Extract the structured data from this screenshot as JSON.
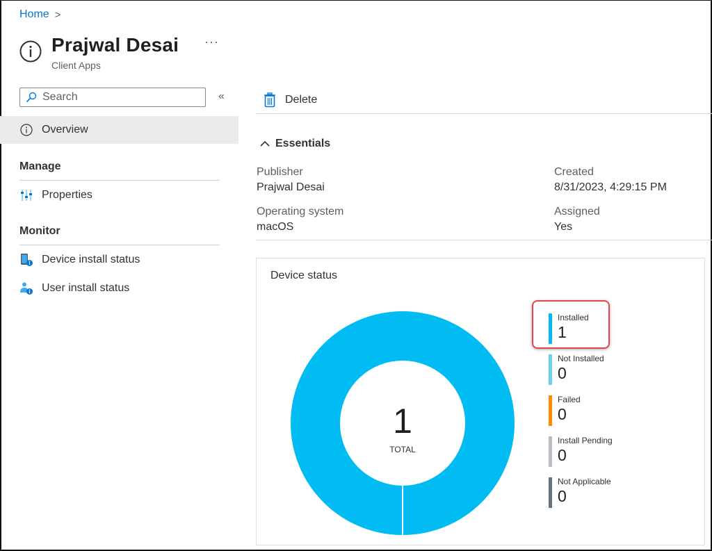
{
  "breadcrumb": {
    "home": "Home",
    "separator": ">"
  },
  "header": {
    "title": "Prajwal Desai",
    "subtitle": "Client Apps",
    "more": "···"
  },
  "sidebar": {
    "search_placeholder": "Search",
    "collapse": "«",
    "overview": "Overview",
    "sections": [
      {
        "heading": "Manage",
        "items": [
          {
            "label": "Properties",
            "icon": "properties-icon"
          }
        ]
      },
      {
        "heading": "Monitor",
        "items": [
          {
            "label": "Device install status",
            "icon": "device-install-status-icon"
          },
          {
            "label": "User install status",
            "icon": "user-install-status-icon"
          }
        ]
      }
    ]
  },
  "toolbar": {
    "delete_label": "Delete"
  },
  "essentials": {
    "toggle_label": "Essentials",
    "fields": [
      {
        "label": "Publisher",
        "value": "Prajwal Desai"
      },
      {
        "label": "Created",
        "value": "8/31/2023, 4:29:15 PM"
      },
      {
        "label": "Operating system",
        "value": "macOS"
      },
      {
        "label": "Assigned",
        "value": "Yes"
      }
    ]
  },
  "device_status": {
    "title": "Device status",
    "total_value": "1",
    "total_label": "TOTAL",
    "legend": [
      {
        "name": "Installed",
        "value": 1,
        "color": "#00bcf2",
        "highlighted": true
      },
      {
        "name": "Not Installed",
        "value": 0,
        "color": "#6dd1f4"
      },
      {
        "name": "Failed",
        "value": 0,
        "color": "#ff8c00"
      },
      {
        "name": "Install Pending",
        "value": 0,
        "color": "#b9bdc3"
      },
      {
        "name": "Not Applicable",
        "value": 0,
        "color": "#69737d"
      }
    ]
  },
  "chart_data": {
    "type": "pie",
    "title": "Device status",
    "categories": [
      "Installed",
      "Not Installed",
      "Failed",
      "Install Pending",
      "Not Applicable"
    ],
    "values": [
      1,
      0,
      0,
      0,
      0
    ],
    "total": 1,
    "center_label": "TOTAL",
    "legend_position": "right"
  }
}
